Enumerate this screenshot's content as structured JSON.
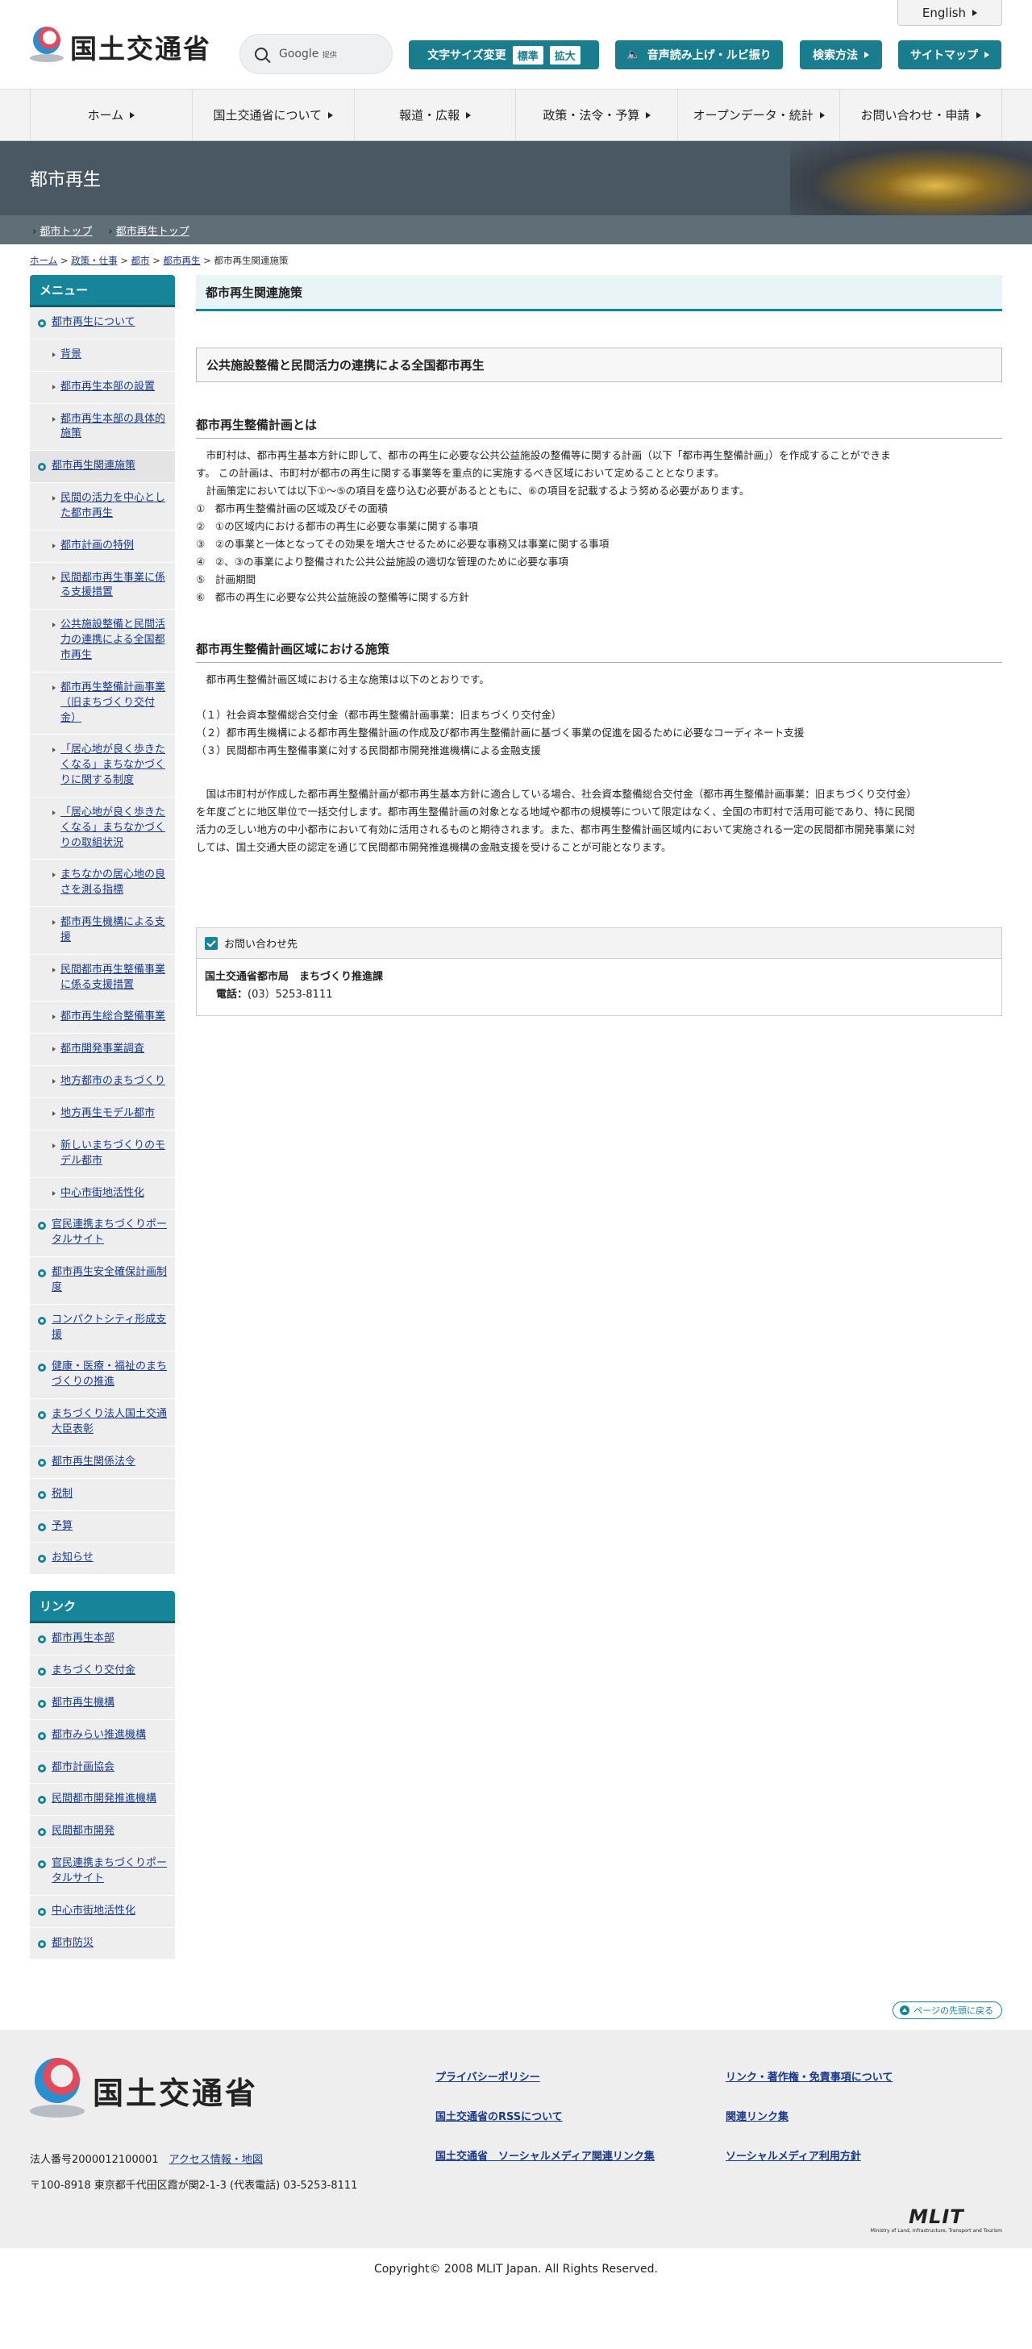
{
  "header": {
    "english": "English",
    "logo_text": "国土交通省",
    "search_brand": "Google",
    "search_provided": "提供",
    "font_size_label": "文字サイズ変更",
    "font_standard": "標準",
    "font_large": "拡大",
    "voice_label": "音声読み上げ・ルビ振り",
    "search_method": "検索方法",
    "sitemap": "サイトマップ"
  },
  "gnav": [
    "ホーム",
    "国土交通省について",
    "報道・広報",
    "政策・法令・予算",
    "オープンデータ・統計",
    "お問い合わせ・申請"
  ],
  "banner": {
    "title": "都市再生"
  },
  "subbar": [
    "都市トップ",
    "都市再生トップ"
  ],
  "breadcrumb": {
    "items": [
      "ホーム",
      "政策・仕事",
      "都市",
      "都市再生"
    ],
    "current": "都市再生関連施策",
    "sep": ">"
  },
  "menu": {
    "title": "メニュー",
    "items": [
      {
        "label": "都市再生について",
        "sub": false
      },
      {
        "label": "背景",
        "sub": true
      },
      {
        "label": "都市再生本部の設置",
        "sub": true
      },
      {
        "label": "都市再生本部の具体的施策",
        "sub": true
      },
      {
        "label": "都市再生関連施策",
        "sub": false
      },
      {
        "label": "民間の活力を中心とした都市再生",
        "sub": true
      },
      {
        "label": "都市計画の特例",
        "sub": true
      },
      {
        "label": "民間都市再生事業に係る支援措置",
        "sub": true
      },
      {
        "label": "公共施設整備と民間活力の連携による全国都市再生",
        "sub": true
      },
      {
        "label": "都市再生整備計画事業（旧まちづくり交付金）",
        "sub": true
      },
      {
        "label": "「居心地が良く歩きたくなる」まちなかづくりに関する制度",
        "sub": true
      },
      {
        "label": "「居心地が良く歩きたくなる」まちなかづくりの取組状況",
        "sub": true
      },
      {
        "label": "まちなかの居心地の良さを測る指標",
        "sub": true
      },
      {
        "label": "都市再生機構による支援",
        "sub": true
      },
      {
        "label": "民間都市再生整備事業に係る支援措置",
        "sub": true
      },
      {
        "label": "都市再生総合整備事業",
        "sub": true
      },
      {
        "label": "都市開発事業調査",
        "sub": true
      },
      {
        "label": "地方都市のまちづくり",
        "sub": true
      },
      {
        "label": "地方再生モデル都市",
        "sub": true
      },
      {
        "label": "新しいまちづくりのモデル都市",
        "sub": true
      },
      {
        "label": "中心市街地活性化",
        "sub": true
      },
      {
        "label": "官民連携まちづくりポータルサイト",
        "sub": false
      },
      {
        "label": "都市再生安全確保計画制度",
        "sub": false
      },
      {
        "label": "コンパクトシティ形成支援",
        "sub": false
      },
      {
        "label": "健康・医療・福祉のまちづくりの推進",
        "sub": false
      },
      {
        "label": "まちづくり法人国土交通大臣表彰",
        "sub": false
      },
      {
        "label": "都市再生関係法令",
        "sub": false
      },
      {
        "label": "税制",
        "sub": false
      },
      {
        "label": "予算",
        "sub": false
      },
      {
        "label": "お知らせ",
        "sub": false
      }
    ]
  },
  "links": {
    "title": "リンク",
    "items": [
      "都市再生本部",
      "まちづくり交付金",
      "都市再生機構",
      "都市みらい推進機構",
      "都市計画協会",
      "民間都市開発推進機構",
      "民間都市開発",
      "官民連携まちづくりポータルサイト",
      "中心市街地活性化",
      "都市防災"
    ]
  },
  "content": {
    "page_heading": "都市再生関連施策",
    "section_heading": "公共施設整備と民間活力の連携による全国都市再生",
    "h_plan": "都市再生整備計画とは",
    "plan_para_lines": [
      "市町村は、都市再生基本方針に即して、都市の再生に必要な公共公益施設の整備等に関する計画（以下「都市再生整備計画」）を作成することができま",
      "す。 この計画は、市町村が都市の再生に関する事業等を重点的に実施するべき区域において定めることとなります。",
      "　計画策定においては以下①～⑤の項目を盛り込む必要があるとともに、⑥の項目を記載するよう努める必要があります。"
    ],
    "plan_items": [
      "①　都市再生整備計画の区域及びその面積",
      "②　①の区域内における都市の再生に必要な事業に関する事項",
      "③　②の事業と一体となってその効果を増大させるために必要な事務又は事業に関する事項",
      "④　②、③の事業により整備された公共公益施設の適切な管理のために必要な事項",
      "⑤　計画期間",
      "⑥　都市の再生に必要な公共公益施設の整備等に関する方針"
    ],
    "h_area": "都市再生整備計画区域における施策",
    "area_intro": "都市再生整備計画区域における主な施策は以下のとおりです。",
    "area_items": [
      "（１）社会資本整備総合交付金（都市再生整備計画事業：旧まちづくり交付金）",
      "（２）都市再生機構による都市再生整備計画の作成及び都市再生整備計画に基づく事業の促進を図るために必要なコーディネート支援",
      "（３）民間都市再生整備事業に対する民間都市開発推進機構による金融支援"
    ],
    "area_para_lines": [
      "国は市町村が作成した都市再生整備計画が都市再生基本方針に適合している場合、社会資本整備総合交付金（都市再生整備計画事業：旧まちづくり交付金）",
      "を年度ごとに地区単位で一括交付します。都市再生整備計画の対象となる地域や都市の規模等について限定はなく、全国の市町村で活用可能であり、特に民間",
      "活力の乏しい地方の中小都市において有効に活用されるものと期待されます。また、都市再生整備計画区域内において実施される一定の民間都市開発事業に対",
      "しては、国土交通大臣の認定を通じて民間都市開発推進機構の金融支援を受けることが可能となります。"
    ]
  },
  "contact": {
    "title": "お問い合わせ先",
    "org": "国土交通省都市局　まちづくり推進課",
    "tel_label": "電話：",
    "tel": "(03）5253-8111"
  },
  "pagetop": "ページの先頭に戻る",
  "footer": {
    "logo_text": "国土交通省",
    "corp_no": "法人番号2000012100001",
    "access": "アクセス情報・地図",
    "address": "〒100-8918 東京都千代田区霞が関2-1-3 (代表電話) 03-5253-8111",
    "links": [
      "プライバシーポリシー",
      "リンク・著作権・免責事項について",
      "国土交通省のRSSについて",
      "関連リンク集",
      "国土交通省　ソーシャルメディア関連リンク集",
      "ソーシャルメディア利用方針"
    ],
    "mlit": "MLIT",
    "mlit_sub": "Ministry of Land, Infrastructure, Transport and Tourism",
    "copyright": "Copyright© 2008 MLIT Japan. All Rights Reserved."
  }
}
